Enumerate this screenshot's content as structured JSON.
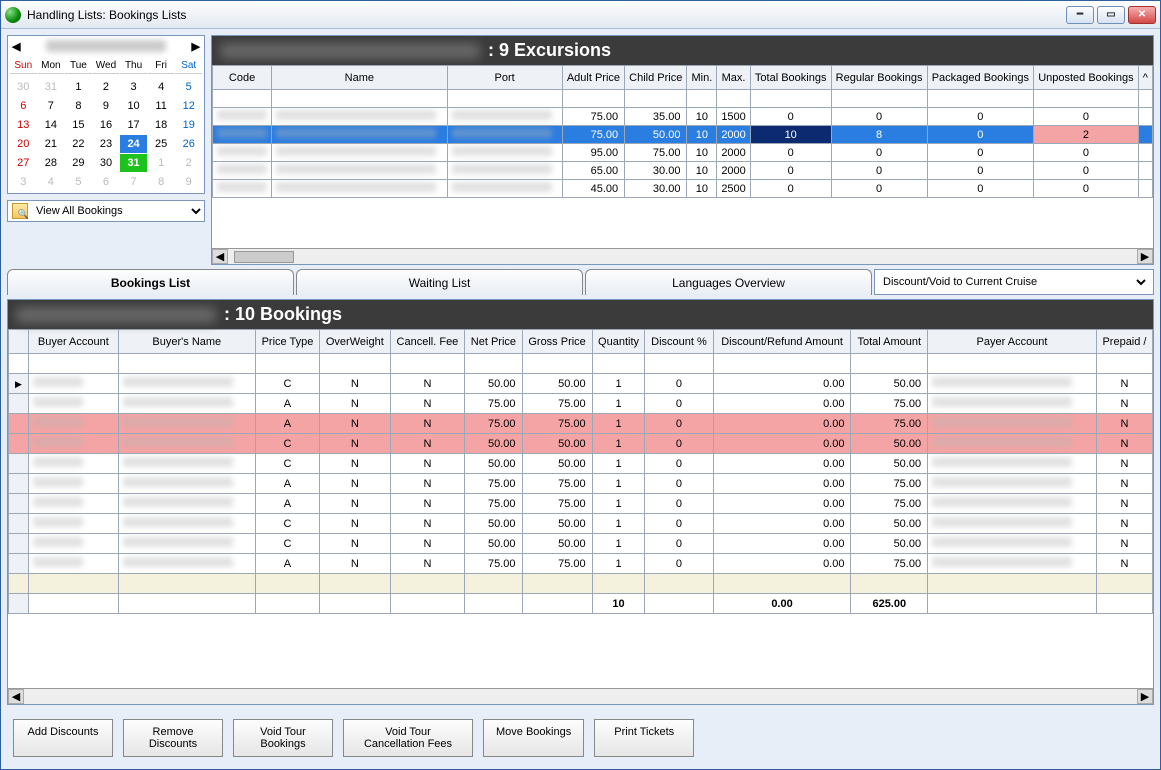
{
  "window": {
    "title": "Handling Lists: Bookings Lists"
  },
  "calendar": {
    "dows": [
      "Sun",
      "Mon",
      "Tue",
      "Wed",
      "Thu",
      "Fri",
      "Sat"
    ],
    "weeks": [
      [
        {
          "n": 30,
          "other": true
        },
        {
          "n": 31,
          "other": true
        },
        {
          "n": 1
        },
        {
          "n": 2
        },
        {
          "n": 3
        },
        {
          "n": 4
        },
        {
          "n": 5,
          "sat": true
        }
      ],
      [
        {
          "n": 6,
          "sun": true
        },
        {
          "n": 7
        },
        {
          "n": 8
        },
        {
          "n": 9
        },
        {
          "n": 10
        },
        {
          "n": 11
        },
        {
          "n": 12,
          "sat": true
        }
      ],
      [
        {
          "n": 13,
          "sun": true
        },
        {
          "n": 14
        },
        {
          "n": 15
        },
        {
          "n": 16
        },
        {
          "n": 17
        },
        {
          "n": 18
        },
        {
          "n": 19,
          "sat": true
        }
      ],
      [
        {
          "n": 20,
          "sun": true
        },
        {
          "n": 21
        },
        {
          "n": 22
        },
        {
          "n": 23
        },
        {
          "n": 24,
          "selBlue": true
        },
        {
          "n": 25
        },
        {
          "n": 26,
          "sat": true
        }
      ],
      [
        {
          "n": 27,
          "sun": true
        },
        {
          "n": 28
        },
        {
          "n": 29
        },
        {
          "n": 30
        },
        {
          "n": 31,
          "selGreen": true
        },
        {
          "n": 1,
          "other": true
        },
        {
          "n": 2,
          "other": true
        }
      ],
      [
        {
          "n": 3,
          "other": true
        },
        {
          "n": 4,
          "other": true
        },
        {
          "n": 5,
          "other": true
        },
        {
          "n": 6,
          "other": true
        },
        {
          "n": 7,
          "other": true
        },
        {
          "n": 8,
          "other": true
        },
        {
          "n": 9,
          "other": true
        }
      ]
    ],
    "view_select": "View All Bookings"
  },
  "excursions": {
    "title_suffix": ": 9 Excursions",
    "columns": [
      "Code",
      "Name",
      "Port",
      "Adult Price",
      "Child Price",
      "Min.",
      "Max.",
      "Total Bookings",
      "Regular Bookings",
      "Packaged Bookings",
      "Unposted Bookings",
      "^"
    ],
    "rows": [
      {
        "adult": "75.00",
        "child": "35.00",
        "min": "10",
        "max": "1500",
        "total": "0",
        "reg": "0",
        "pkg": "0",
        "unp": "0"
      },
      {
        "adult": "75.00",
        "child": "50.00",
        "min": "10",
        "max": "2000",
        "total": "10",
        "reg": "8",
        "pkg": "0",
        "unp": "2",
        "selected": true
      },
      {
        "adult": "95.00",
        "child": "75.00",
        "min": "10",
        "max": "2000",
        "total": "0",
        "reg": "0",
        "pkg": "0",
        "unp": "0"
      },
      {
        "adult": "65.00",
        "child": "30.00",
        "min": "10",
        "max": "2000",
        "total": "0",
        "reg": "0",
        "pkg": "0",
        "unp": "0"
      },
      {
        "adult": "45.00",
        "child": "30.00",
        "min": "10",
        "max": "2500",
        "total": "0",
        "reg": "0",
        "pkg": "0",
        "unp": "0"
      }
    ]
  },
  "tabs": {
    "t1": "Bookings List",
    "t2": "Waiting List",
    "t3": "Languages Overview",
    "dropdown": "Discount/Void to Current Cruise"
  },
  "bookings": {
    "title_suffix": ": 10 Bookings",
    "columns": [
      "",
      "Buyer Account",
      "Buyer's Name",
      "Price Type",
      "OverWeight",
      "Cancell. Fee",
      "Net Price",
      "Gross Price",
      "Quantity",
      "Discount %",
      "Discount/Refund Amount",
      "Total Amount",
      "Payer Account",
      "Prepaid / "
    ],
    "rows": [
      {
        "current": true,
        "pt": "C",
        "ow": "N",
        "cf": "N",
        "np": "50.00",
        "gp": "50.00",
        "qty": "1",
        "disc": "0",
        "dra": "0.00",
        "ta": "50.00",
        "pre": "N"
      },
      {
        "pt": "A",
        "ow": "N",
        "cf": "N",
        "np": "75.00",
        "gp": "75.00",
        "qty": "1",
        "disc": "0",
        "dra": "0.00",
        "ta": "75.00",
        "pre": "N"
      },
      {
        "pink": true,
        "pt": "A",
        "ow": "N",
        "cf": "N",
        "np": "75.00",
        "gp": "75.00",
        "qty": "1",
        "disc": "0",
        "dra": "0.00",
        "ta": "75.00",
        "pre": "N"
      },
      {
        "pink": true,
        "pt": "C",
        "ow": "N",
        "cf": "N",
        "np": "50.00",
        "gp": "50.00",
        "qty": "1",
        "disc": "0",
        "dra": "0.00",
        "ta": "50.00",
        "pre": "N"
      },
      {
        "pt": "C",
        "ow": "N",
        "cf": "N",
        "np": "50.00",
        "gp": "50.00",
        "qty": "1",
        "disc": "0",
        "dra": "0.00",
        "ta": "50.00",
        "pre": "N"
      },
      {
        "pt": "A",
        "ow": "N",
        "cf": "N",
        "np": "75.00",
        "gp": "75.00",
        "qty": "1",
        "disc": "0",
        "dra": "0.00",
        "ta": "75.00",
        "pre": "N"
      },
      {
        "pt": "A",
        "ow": "N",
        "cf": "N",
        "np": "75.00",
        "gp": "75.00",
        "qty": "1",
        "disc": "0",
        "dra": "0.00",
        "ta": "75.00",
        "pre": "N"
      },
      {
        "pt": "C",
        "ow": "N",
        "cf": "N",
        "np": "50.00",
        "gp": "50.00",
        "qty": "1",
        "disc": "0",
        "dra": "0.00",
        "ta": "50.00",
        "pre": "N"
      },
      {
        "pt": "C",
        "ow": "N",
        "cf": "N",
        "np": "50.00",
        "gp": "50.00",
        "qty": "1",
        "disc": "0",
        "dra": "0.00",
        "ta": "50.00",
        "pre": "N"
      },
      {
        "pt": "A",
        "ow": "N",
        "cf": "N",
        "np": "75.00",
        "gp": "75.00",
        "qty": "1",
        "disc": "0",
        "dra": "0.00",
        "ta": "75.00",
        "pre": "N"
      }
    ],
    "totals": {
      "qty": "10",
      "dra": "0.00",
      "ta": "625.00"
    }
  },
  "buttons": {
    "add": "Add Discounts",
    "remove": "Remove\nDiscounts",
    "voidTour": "Void Tour\nBookings",
    "voidCancel": "Void Tour\nCancellation Fees",
    "move": "Move Bookings",
    "print": "Print Tickets"
  }
}
